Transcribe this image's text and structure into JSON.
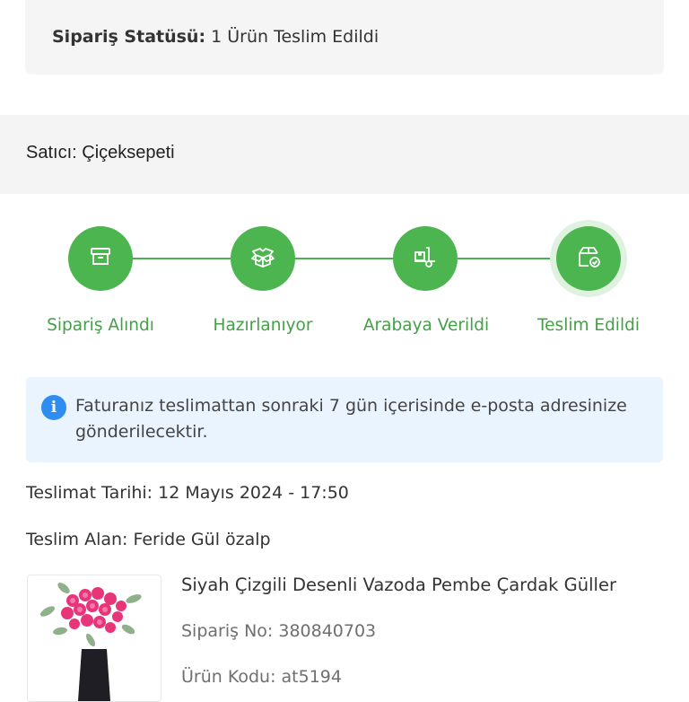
{
  "order": {
    "status_label": "Sipariş Statüsü:",
    "status_value": "1 Ürün Teslim Edildi"
  },
  "seller": {
    "text": "Satıcı: Çiçeksepeti"
  },
  "tracking": {
    "steps": [
      {
        "label": "Sipariş Alındı",
        "icon": "archive-box-icon"
      },
      {
        "label": "Hazırlanıyor",
        "icon": "open-package-icon"
      },
      {
        "label": "Arabaya Verildi",
        "icon": "hand-truck-icon"
      },
      {
        "label": "Teslim Edildi",
        "icon": "box-check-icon"
      }
    ],
    "active_index": 3,
    "accent_color": "#4cb54f"
  },
  "info": {
    "icon": "info-icon",
    "text": "Faturanız teslimattan sonraki 7 gün içerisinde e-posta adresinize gönderilecektir."
  },
  "delivery": {
    "date": "Teslimat Tarihi: 12 Mayıs 2024 - 17:50",
    "receiver": "Teslim Alan: Feride Gül özalp"
  },
  "product": {
    "title": "Siyah Çizgili Desenli Vazoda Pembe Çardak Güller",
    "order_no": "Sipariş No: 380840703",
    "product_code": "Ürün Kodu: at5194"
  }
}
